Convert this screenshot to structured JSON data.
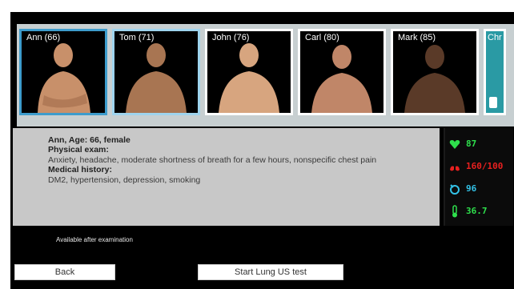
{
  "patients": [
    {
      "label": "Ann (66)",
      "skin": "#c8906a",
      "selected": "primary"
    },
    {
      "label": "Tom (71)",
      "skin": "#a87552",
      "selected": "secondary"
    },
    {
      "label": "John (76)",
      "skin": "#d7a57f",
      "selected": "none"
    },
    {
      "label": "Carl (80)",
      "skin": "#c08668",
      "selected": "none"
    },
    {
      "label": "Mark (85)",
      "skin": "#5a3a28",
      "selected": "none"
    },
    {
      "label": "Chr",
      "skin": "#2a9aa4",
      "selected": "none"
    }
  ],
  "details": {
    "name_line": "Ann, Age: 66, female",
    "physical_exam_heading": "Physical exam:",
    "physical_exam_text": "Anxiety, headache, moderate shortness of breath for a few hours, nonspecific chest pain",
    "medical_history_heading": "Medical history:",
    "medical_history_text": "DM2, hypertension, depression, smoking"
  },
  "vitals": [
    {
      "icon": "heart-rate-icon",
      "value": "87",
      "color": "#2ee04c"
    },
    {
      "icon": "lungs-icon",
      "value": "160/100",
      "color": "#e8201f"
    },
    {
      "icon": "oxygen-saturation-icon",
      "value": "96",
      "color": "#33c3e8"
    },
    {
      "icon": "thermometer-icon",
      "value": "36.7",
      "color": "#2ee04c"
    }
  ],
  "available_note": "Available after examination",
  "buttons": {
    "back": "Back",
    "start": "Start Lung US test"
  }
}
